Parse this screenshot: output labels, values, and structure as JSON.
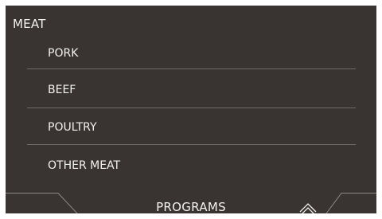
{
  "menu": {
    "title": "MEAT",
    "items": [
      {
        "label": "PORK"
      },
      {
        "label": "BEEF"
      },
      {
        "label": "POULTRY"
      },
      {
        "label": "OTHER MEAT"
      }
    ]
  },
  "footer": {
    "label": "PROGRAMS",
    "arrow_icon": "chevron-up-icon"
  },
  "colors": {
    "background": "#393431",
    "text": "#f2f2f2",
    "divider": "#6e6a67",
    "footer_line": "#8c8884"
  }
}
